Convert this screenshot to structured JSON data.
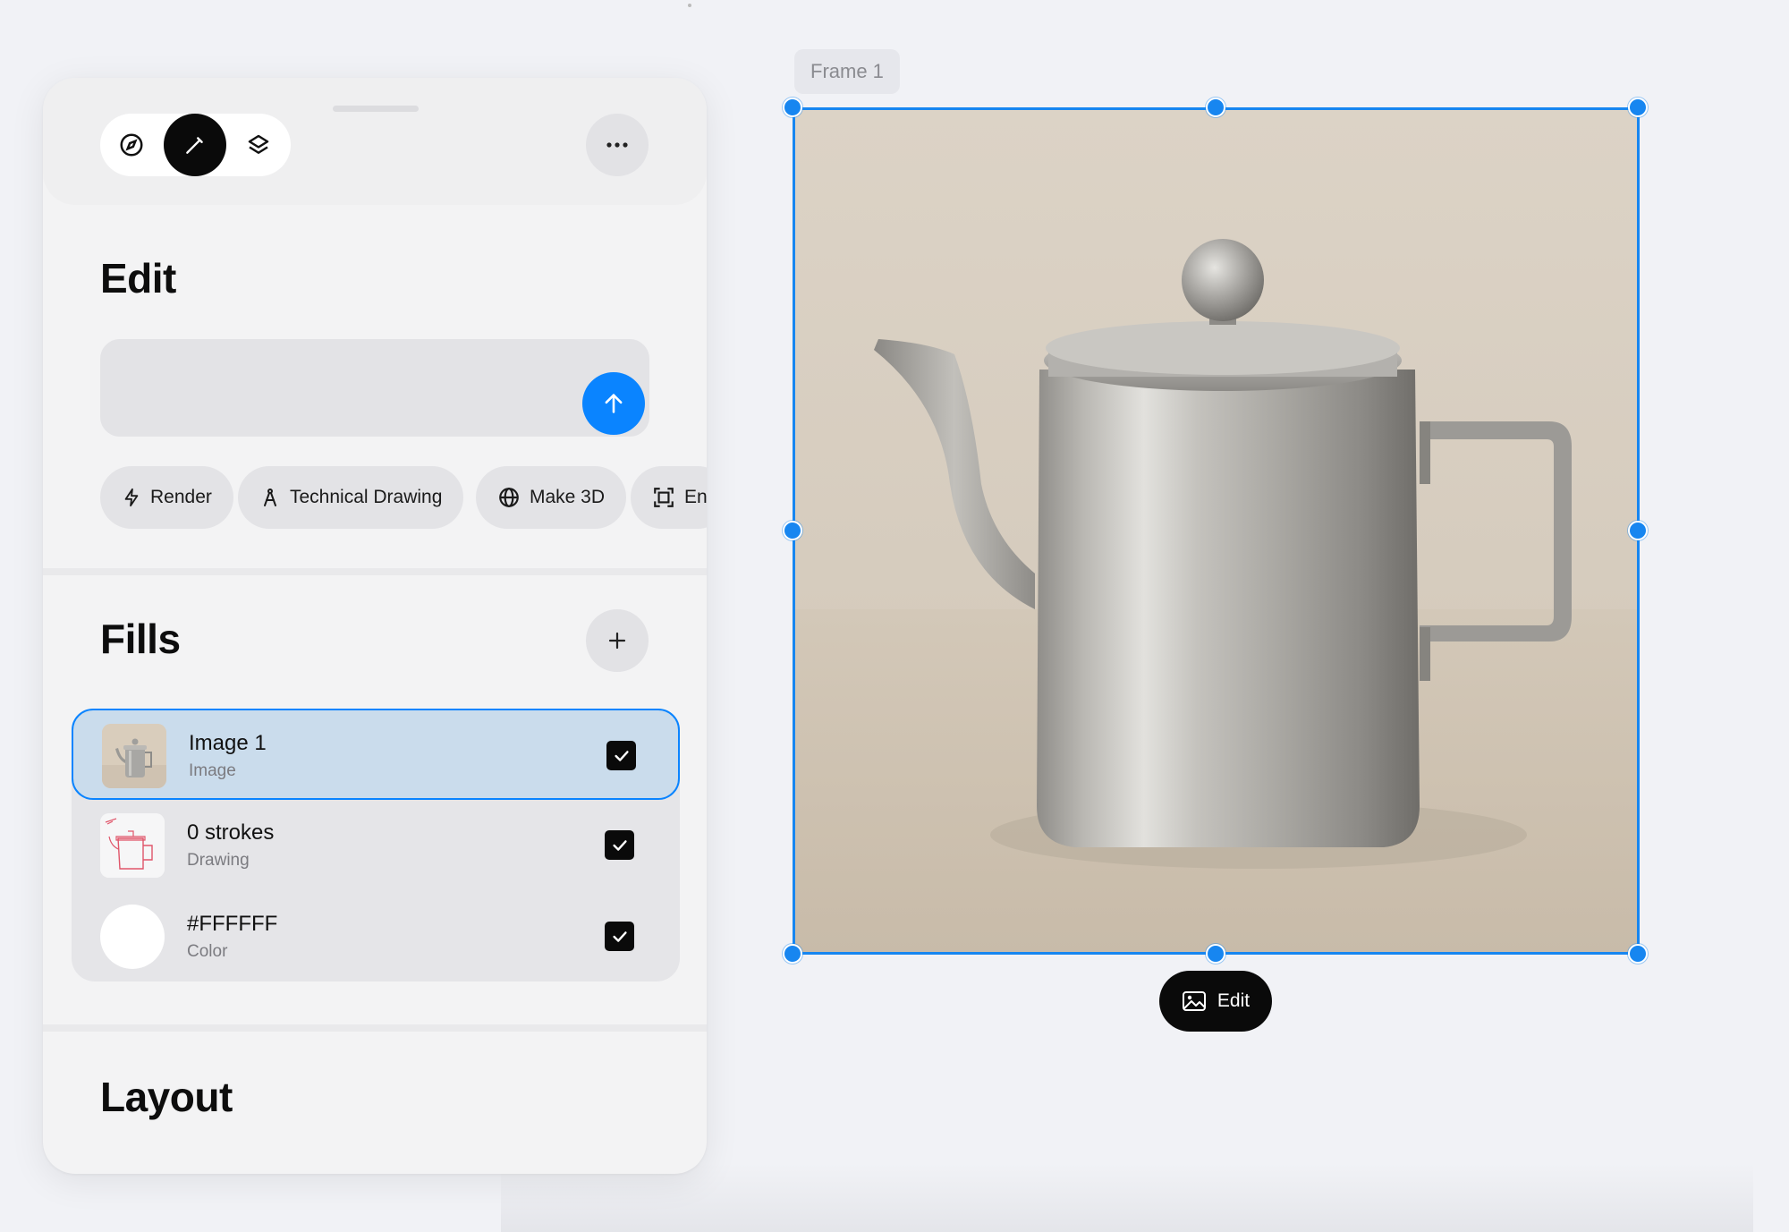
{
  "panel": {
    "modes": [
      {
        "name": "explore",
        "icon": "compass-icon",
        "active": false
      },
      {
        "name": "edit",
        "icon": "pencil-icon",
        "active": true
      },
      {
        "name": "layers",
        "icon": "layers-icon",
        "active": false
      }
    ],
    "more_icon": "ellipsis-icon"
  },
  "edit": {
    "title": "Edit",
    "prompt_value": "",
    "send_icon": "arrow-up-icon",
    "chips": [
      {
        "label": "Render",
        "icon": "bolt-icon"
      },
      {
        "label": "Technical Drawing",
        "icon": "compass-drafting-icon"
      },
      {
        "label": "Make 3D",
        "icon": "globe-icon"
      },
      {
        "label": "En",
        "icon": "frame-focus-icon"
      }
    ]
  },
  "fills": {
    "title": "Fills",
    "add_icon": "plus-icon",
    "items": [
      {
        "name": "Image 1",
        "type": "Image",
        "checked": true,
        "selected": true
      },
      {
        "name": "0 strokes",
        "type": "Drawing",
        "checked": true,
        "selected": false
      },
      {
        "name": "#FFFFFF",
        "type": "Color",
        "checked": true,
        "selected": false
      }
    ]
  },
  "layout": {
    "title": "Layout"
  },
  "canvas": {
    "frame_label": "Frame 1",
    "edit_button_label": "Edit",
    "edit_button_icon": "image-icon"
  },
  "colors": {
    "accent": "#0a84ff",
    "selection": "#1786f0",
    "selected_row": "#cadcec"
  }
}
